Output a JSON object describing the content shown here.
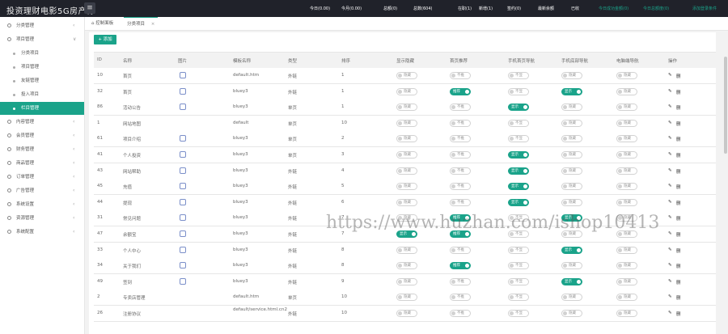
{
  "app": {
    "title": "投资理财电影5G房产源",
    "menu_icon": "hamburger-icon"
  },
  "top_stats": [
    "今日(0.00)",
    "今月(0.00)",
    "总额(0)",
    "总数(604)",
    "在职(1)",
    "新增(1)",
    "签约(0)",
    "最新余额",
    "已收",
    "今日成功金额(0)",
    "今日总额度(0)",
    "添加登录条件"
  ],
  "sidebar": {
    "items": [
      {
        "label": "分类管理",
        "sub": false,
        "arrow": "‹"
      },
      {
        "label": "项目管理",
        "sub": false,
        "arrow": "∨"
      },
      {
        "label": "分类项目",
        "sub": true
      },
      {
        "label": "项目管理",
        "sub": true
      },
      {
        "label": "友链管理",
        "sub": true
      },
      {
        "label": "投入项目",
        "sub": true
      },
      {
        "label": "栏目管理",
        "sub": true,
        "active": true
      },
      {
        "label": "内容管理",
        "sub": false,
        "arrow": "‹"
      },
      {
        "label": "会员管理",
        "sub": false,
        "arrow": "‹"
      },
      {
        "label": "财务管理",
        "sub": false,
        "arrow": "‹"
      },
      {
        "label": "商品管理",
        "sub": false,
        "arrow": "‹"
      },
      {
        "label": "订单管理",
        "sub": false,
        "arrow": "‹"
      },
      {
        "label": "广告管理",
        "sub": false,
        "arrow": "‹"
      },
      {
        "label": "系统设置",
        "sub": false,
        "arrow": "‹"
      },
      {
        "label": "资源管理",
        "sub": false,
        "arrow": "‹"
      },
      {
        "label": "系统配置",
        "sub": false,
        "arrow": "‹"
      }
    ]
  },
  "tabs": [
    {
      "label": "控制面板",
      "icon": "home-icon"
    },
    {
      "label": "分类项目",
      "close": "×"
    }
  ],
  "add_button": "+ 添加",
  "columns": [
    "ID",
    "名称",
    "图片",
    "模板名称",
    "类型",
    "排序",
    "显示隐藏",
    "首页推荐",
    "手机首页导航",
    "手机底部导航",
    "电脑端导航",
    "操作"
  ],
  "rows": [
    {
      "id": "10",
      "name": "首页",
      "tpl": "default.htm",
      "type": "外链",
      "sort": "1",
      "icon": "file-icon",
      "s": [
        0,
        0,
        0,
        0,
        0
      ],
      "labels": [
        "隐藏",
        "不推",
        "不显",
        "隐藏",
        "隐藏"
      ]
    },
    {
      "id": "32",
      "name": "首页",
      "tpl": "bluey3",
      "type": "外链",
      "sort": "1",
      "icon": "copy-icon",
      "s": [
        0,
        1,
        0,
        1,
        0
      ],
      "labels": [
        "隐藏",
        "推荐",
        "不显",
        "显示",
        "隐藏"
      ]
    },
    {
      "id": "86",
      "name": "活动公告",
      "tpl": "bluey3",
      "type": "单页",
      "sort": "1",
      "icon": "mail-icon",
      "s": [
        0,
        0,
        1,
        0,
        0
      ],
      "labels": [
        "隐藏",
        "不推",
        "显示",
        "隐藏",
        "隐藏"
      ]
    },
    {
      "id": "1",
      "name": "网站地图",
      "tpl": "default",
      "type": "单页",
      "sort": "10",
      "icon": "",
      "s": [
        0,
        0,
        0,
        0,
        0
      ],
      "labels": [
        "隐藏",
        "不推",
        "不显",
        "隐藏",
        "隐藏"
      ]
    },
    {
      "id": "61",
      "name": "项目介绍",
      "tpl": "bluey3",
      "type": "单页",
      "sort": "2",
      "icon": "doc-icon",
      "s": [
        0,
        0,
        0,
        0,
        0
      ],
      "labels": [
        "隐藏",
        "不推",
        "不显",
        "隐藏",
        "隐藏"
      ]
    },
    {
      "id": "41",
      "name": "个人投资",
      "tpl": "bluey3",
      "type": "单页",
      "sort": "3",
      "icon": "share-icon",
      "s": [
        0,
        0,
        1,
        0,
        0
      ],
      "labels": [
        "隐藏",
        "不推",
        "显示",
        "隐藏",
        "隐藏"
      ]
    },
    {
      "id": "43",
      "name": "网站帮助",
      "tpl": "bluey3",
      "type": "外链",
      "sort": "4",
      "icon": "link-icon",
      "s": [
        0,
        0,
        1,
        0,
        0
      ],
      "labels": [
        "隐藏",
        "不推",
        "显示",
        "隐藏",
        "隐藏"
      ]
    },
    {
      "id": "45",
      "name": "充值",
      "tpl": "bluey3",
      "type": "外链",
      "sort": "5",
      "icon": "yen-icon",
      "s": [
        0,
        0,
        1,
        0,
        0
      ],
      "labels": [
        "隐藏",
        "不推",
        "显示",
        "隐藏",
        "隐藏"
      ]
    },
    {
      "id": "44",
      "name": "提现",
      "tpl": "bluey3",
      "type": "外链",
      "sort": "6",
      "icon": "wallet-icon",
      "s": [
        0,
        0,
        1,
        0,
        0
      ],
      "labels": [
        "隐藏",
        "不推",
        "显示",
        "隐藏",
        "隐藏"
      ]
    },
    {
      "id": "31",
      "name": "常见问题",
      "tpl": "bluey3",
      "type": "外链",
      "sort": "7",
      "icon": "cube-icon",
      "s": [
        0,
        1,
        0,
        1,
        0
      ],
      "labels": [
        "隐藏",
        "推荐",
        "不显",
        "显示",
        "隐藏"
      ]
    },
    {
      "id": "47",
      "name": "余额宝",
      "tpl": "bluey3",
      "type": "外链",
      "sort": "7",
      "icon": "fire-icon",
      "s": [
        1,
        1,
        0,
        0,
        0
      ],
      "labels": [
        "显示",
        "推荐",
        "不显",
        "隐藏",
        "隐藏"
      ]
    },
    {
      "id": "33",
      "name": "个人中心",
      "tpl": "bluey3",
      "type": "外链",
      "sort": "8",
      "icon": "user-icon",
      "s": [
        0,
        0,
        0,
        1,
        0
      ],
      "labels": [
        "隐藏",
        "不推",
        "不显",
        "显示",
        "隐藏"
      ]
    },
    {
      "id": "34",
      "name": "关于我们",
      "tpl": "bluey3",
      "type": "外链",
      "sort": "8",
      "icon": "compass-icon",
      "s": [
        0,
        1,
        0,
        0,
        0
      ],
      "labels": [
        "隐藏",
        "推荐",
        "不显",
        "隐藏",
        "隐藏"
      ]
    },
    {
      "id": "49",
      "name": "签到",
      "tpl": "bluey3",
      "type": "外链",
      "sort": "9",
      "icon": "person-icon",
      "s": [
        0,
        0,
        0,
        1,
        0
      ],
      "labels": [
        "隐藏",
        "不推",
        "不显",
        "显示",
        "隐藏"
      ]
    },
    {
      "id": "2",
      "name": "专卖店管理",
      "tpl": "default.htm",
      "type": "单页",
      "sort": "10",
      "icon": "",
      "s": [
        0,
        0,
        0,
        0,
        0
      ],
      "labels": [
        "隐藏",
        "不推",
        "不显",
        "隐藏",
        "隐藏"
      ]
    },
    {
      "id": "26",
      "name": "注册协议",
      "tpl": "default/service.html.cn2",
      "type": "外链",
      "sort": "10",
      "icon": "",
      "s": [
        0,
        0,
        0,
        0,
        0
      ],
      "labels": [
        "隐藏",
        "不推",
        "不显",
        "隐藏",
        "隐藏"
      ]
    }
  ],
  "actions": {
    "edit_icon": "pencil-icon",
    "edit_glyph": "✎",
    "delete_label": "删"
  },
  "watermark": "https://www.huzhan.com/ishop10413"
}
